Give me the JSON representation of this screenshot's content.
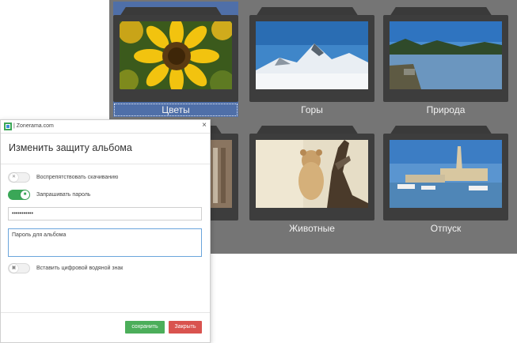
{
  "albums": [
    {
      "label": "Цветы",
      "selected": true,
      "photo": "sunflower"
    },
    {
      "label": "Горы",
      "selected": false,
      "photo": "snowy-mountains"
    },
    {
      "label": "Природа",
      "selected": false,
      "photo": "lake"
    },
    {
      "label": "",
      "selected": false,
      "photo": "city-street"
    },
    {
      "label": "Животные",
      "selected": false,
      "photo": "lion-cub"
    },
    {
      "label": "Отпуск",
      "selected": false,
      "photo": "harbor"
    }
  ],
  "dialog": {
    "app_title": "| Zonerama.com",
    "close_icon": "×",
    "heading": "Изменить защиту альбома",
    "options": {
      "prevent_download": {
        "label": "Воспрепятствовать скачиванию",
        "on": false
      },
      "require_password": {
        "label": "Запрашивать пароль",
        "on": true
      },
      "watermark": {
        "label": "Вставить цифровой водяной знак",
        "on": false
      }
    },
    "password_value": "•••••••••••",
    "password_hint": "Пароль для альбома",
    "save_label": "сохранить",
    "close_label": "Закрыть"
  },
  "colors": {
    "accent_green": "#3aa757",
    "save_button": "#4cae5a",
    "close_button": "#d9534f",
    "selected_album": "#4f6fa8",
    "gallery_bg": "#757575"
  }
}
